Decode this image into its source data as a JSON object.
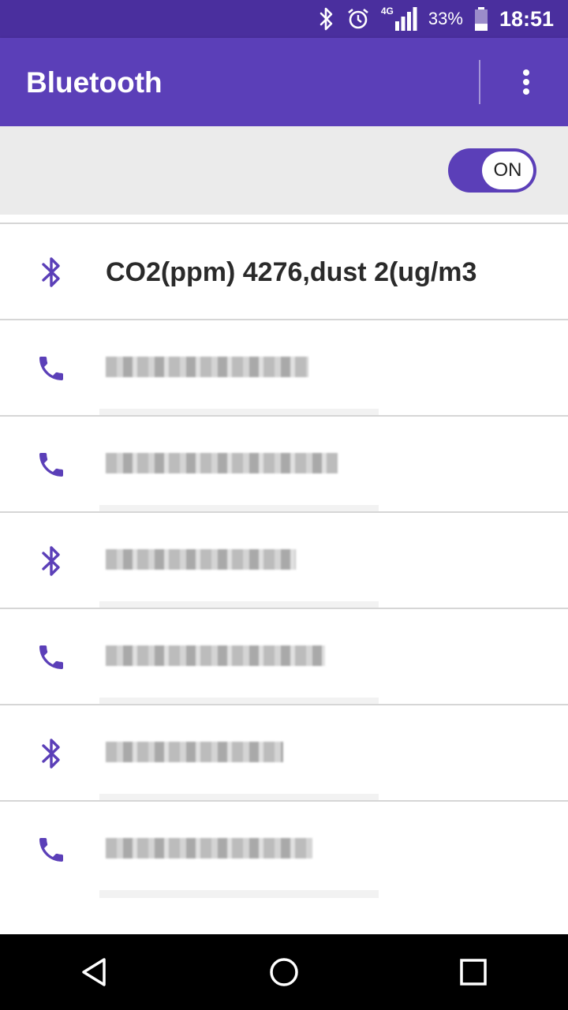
{
  "status_bar": {
    "network": "4G",
    "battery_percent": "33%",
    "battery_level": 0.33,
    "time": "18:51",
    "icons": [
      "bluetooth-icon",
      "alarm-icon",
      "signal-icon",
      "battery-icon"
    ]
  },
  "app_bar": {
    "title": "Bluetooth",
    "menu_icon": "overflow-menu-icon"
  },
  "toggle": {
    "label": "ON",
    "state": true
  },
  "devices": [
    {
      "icon": "bluetooth-icon",
      "label": "CO2(ppm) 4276,dust 2(ug/m3",
      "redacted": false
    },
    {
      "icon": "phone-icon",
      "label": "",
      "redacted": true
    },
    {
      "icon": "phone-icon",
      "label": "",
      "redacted": true
    },
    {
      "icon": "bluetooth-icon",
      "label": "",
      "redacted": true
    },
    {
      "icon": "phone-icon",
      "label": "",
      "redacted": true
    },
    {
      "icon": "bluetooth-icon",
      "label": "",
      "redacted": true
    },
    {
      "icon": "phone-icon",
      "label": "",
      "redacted": true
    }
  ],
  "nav_bar": {
    "buttons": [
      "back-icon",
      "home-icon",
      "recents-icon"
    ]
  },
  "colors": {
    "status_bar": "#4a2f9e",
    "app_bar": "#5b3fb8",
    "accent": "#5b3fb8"
  }
}
